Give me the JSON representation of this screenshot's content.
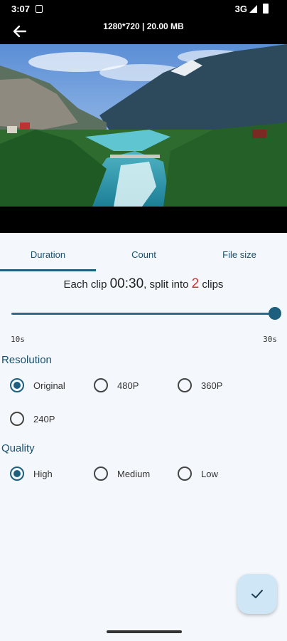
{
  "status_bar": {
    "time": "3:07",
    "network": "3G"
  },
  "top_bar": {
    "video_info": "1280*720 | 20.00 MB"
  },
  "tabs": [
    {
      "label": "Duration",
      "selected": true
    },
    {
      "label": "Count",
      "selected": false
    },
    {
      "label": "File size",
      "selected": false
    }
  ],
  "summary": {
    "prefix": "Each clip ",
    "clip_duration": "00:30",
    "middle": ", split into ",
    "clip_count": "2",
    "suffix": " clips"
  },
  "slider": {
    "min_label": "10s",
    "max_label": "30s",
    "value_fraction": 1.0
  },
  "resolution": {
    "title": "Resolution",
    "options": [
      {
        "label": "Original",
        "checked": true
      },
      {
        "label": "480P",
        "checked": false
      },
      {
        "label": "360P",
        "checked": false
      },
      {
        "label": "240P",
        "checked": false
      }
    ]
  },
  "quality": {
    "title": "Quality",
    "options": [
      {
        "label": "High",
        "checked": true
      },
      {
        "label": "Medium",
        "checked": false
      },
      {
        "label": "Low",
        "checked": false
      }
    ]
  },
  "colors": {
    "accent": "#1f5f7e",
    "count_highlight": "#d32f2f",
    "fab_bg": "#cfe6f6"
  },
  "icons": {
    "back": "arrow-left-icon",
    "confirm": "check-icon"
  }
}
